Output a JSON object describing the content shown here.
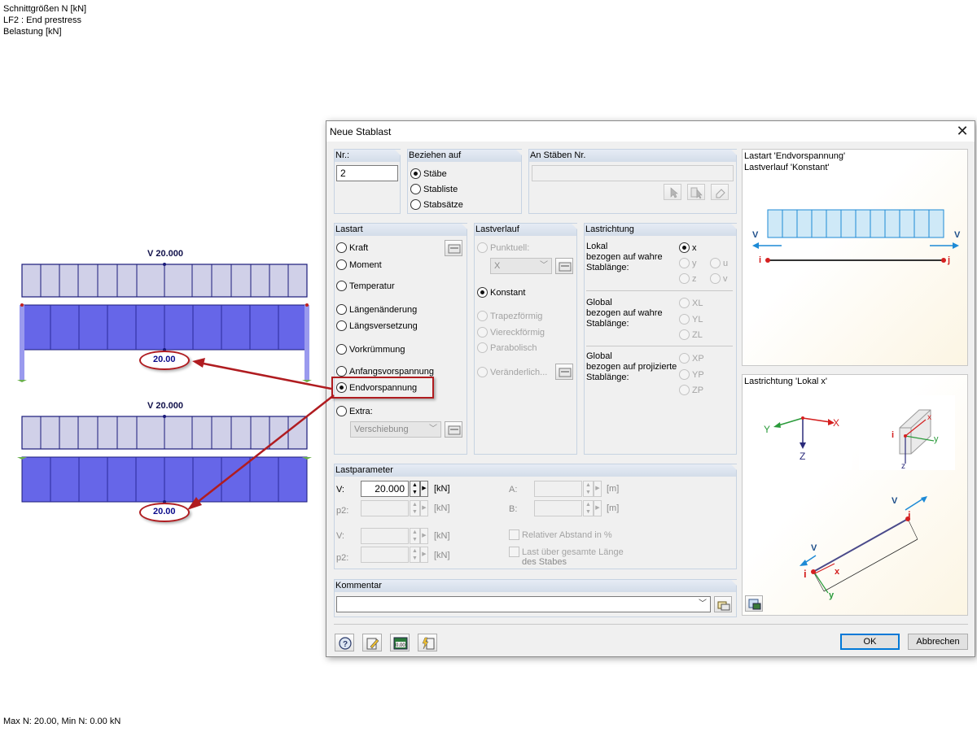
{
  "canvas": {
    "info_lines": [
      "Schnittgrößen N [kN]",
      "LF2 : End prestress",
      "Belastung [kN]"
    ],
    "footer": "Max N: 20.00, Min N: 0.00 kN",
    "beam1_label": "V 20.000",
    "beam1_value": "20.00",
    "beam2_label": "V 20.000",
    "beam2_value": "20.00"
  },
  "dialog": {
    "title": "Neue Stablast",
    "close_glyph": "✕",
    "nr": {
      "header": "Nr.:",
      "value": "2"
    },
    "beziehen": {
      "header": "Beziehen auf",
      "options": [
        "Stäbe",
        "Stabliste",
        "Stabsätze"
      ],
      "selected": 0
    },
    "an_staeben": {
      "header": "An Stäben Nr.",
      "value": ""
    },
    "lastart": {
      "header": "Lastart",
      "options": [
        "Kraft",
        "Moment",
        "Temperatur",
        "Längenänderung",
        "Längsversetzung",
        "Vorkrümmung",
        "Anfangsvorspannung",
        "Endvorspannung",
        "Extra:"
      ],
      "selected": 7,
      "extra_combo": "Verschiebung"
    },
    "lastverlauf": {
      "header": "Lastverlauf",
      "punktuell": "Punktuell:",
      "punktuell_combo": "X",
      "konstant": "Konstant",
      "others": [
        "Trapezförmig",
        "Viereckförmig",
        "Parabolisch"
      ],
      "veraenderlich": "Veränderlich..."
    },
    "lastrichtung": {
      "header": "Lastrichtung",
      "lokal_label": "Lokal\nbezogen auf wahre\nStablänge:",
      "lokal_options": [
        "x",
        "y",
        "u",
        "z",
        "v"
      ],
      "global_label": "Global\nbezogen auf wahre\nStablänge:",
      "global_options": [
        "XL",
        "YL",
        "ZL"
      ],
      "global_proj_label": "Global\nbezogen auf projizierte\nStablänge:",
      "global_proj_options": [
        "XP",
        "YP",
        "ZP"
      ]
    },
    "lastparameter": {
      "header": "Lastparameter",
      "v_label": "V:",
      "v_value": "20.000",
      "p2_label": "p2:",
      "v2_label": "V:",
      "p22_label": "p2:",
      "unit_kn": "[kN]",
      "a_label": "A:",
      "b_label": "B:",
      "unit_m": "[m]",
      "relativ": "Relativer Abstand in %",
      "last_ueber_1": "Last über gesamte Länge",
      "last_ueber_2": "des Stabes"
    },
    "kommentar": {
      "header": "Kommentar",
      "value": ""
    },
    "preview_top": {
      "line1": "Lastart 'Endvorspannung'",
      "line2": "Lastverlauf 'Konstant'",
      "v_left": "V",
      "v_right": "V",
      "i": "i",
      "j": "j"
    },
    "preview_bottom": {
      "title": "Lastrichtung 'Lokal x'",
      "axis_y": "Y",
      "axis_x": "X",
      "axis_z": "Z",
      "loc_i": "i",
      "loc_x": "x",
      "loc_y": "y",
      "loc_z": "z",
      "beam_v_top": "V",
      "beam_j": "j",
      "beam_v_bot": "V",
      "beam_i": "i",
      "beam_x": "x",
      "beam_y": "y"
    },
    "ok_label": "OK",
    "cancel_label": "Abbrechen",
    "colors": {
      "accent": "#0078d7",
      "load_fill": "#cfe9f7",
      "arrow": "#1d8ad6",
      "member_red": "#d42020",
      "callout": "#b01c20"
    }
  }
}
